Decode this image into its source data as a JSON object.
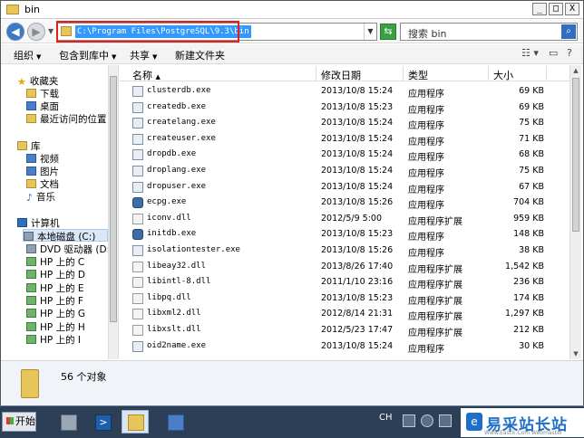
{
  "window": {
    "title": "bin",
    "controls": [
      "_",
      "□",
      "X"
    ]
  },
  "address": {
    "path": "C:\\Program Files\\PostgreSQL\\9.3\\bin",
    "search_placeholder": "搜索 bin"
  },
  "toolbar": {
    "organize": "组织",
    "include_in_library": "包含到库中",
    "share": "共享",
    "new_folder": "新建文件夹"
  },
  "nav": {
    "favorites": "收藏夹",
    "downloads": "下载",
    "desktop": "桌面",
    "recent": "最近访问的位置",
    "libraries": "库",
    "videos": "视频",
    "pictures": "图片",
    "documents": "文档",
    "music": "音乐",
    "computer": "计算机",
    "local_disk": "本地磁盘 (C:)",
    "dvd_drive": "DVD 驱动器 (D:)",
    "net_drives": [
      "HP 上的 C",
      "HP 上的 D",
      "HP 上的 E",
      "HP 上的 F",
      "HP 上的 G",
      "HP 上的 H",
      "HP 上的 I"
    ]
  },
  "columns": {
    "name": "名称",
    "modified": "修改日期",
    "type": "类型",
    "size": "大小"
  },
  "files": [
    {
      "name": "clusterdb.exe",
      "date": "2013/10/8 15:24",
      "type": "应用程序",
      "size": "69 KB",
      "kind": "exe"
    },
    {
      "name": "createdb.exe",
      "date": "2013/10/8 15:23",
      "type": "应用程序",
      "size": "69 KB",
      "kind": "exe"
    },
    {
      "name": "createlang.exe",
      "date": "2013/10/8 15:24",
      "type": "应用程序",
      "size": "75 KB",
      "kind": "exe"
    },
    {
      "name": "createuser.exe",
      "date": "2013/10/8 15:24",
      "type": "应用程序",
      "size": "71 KB",
      "kind": "exe"
    },
    {
      "name": "dropdb.exe",
      "date": "2013/10/8 15:24",
      "type": "应用程序",
      "size": "68 KB",
      "kind": "exe"
    },
    {
      "name": "droplang.exe",
      "date": "2013/10/8 15:24",
      "type": "应用程序",
      "size": "75 KB",
      "kind": "exe"
    },
    {
      "name": "dropuser.exe",
      "date": "2013/10/8 15:24",
      "type": "应用程序",
      "size": "67 KB",
      "kind": "exe"
    },
    {
      "name": "ecpg.exe",
      "date": "2013/10/8 15:26",
      "type": "应用程序",
      "size": "704 KB",
      "kind": "special"
    },
    {
      "name": "iconv.dll",
      "date": "2012/5/9 5:00",
      "type": "应用程序扩展",
      "size": "959 KB",
      "kind": "dll"
    },
    {
      "name": "initdb.exe",
      "date": "2013/10/8 15:23",
      "type": "应用程序",
      "size": "148 KB",
      "kind": "special"
    },
    {
      "name": "isolationtester.exe",
      "date": "2013/10/8 15:26",
      "type": "应用程序",
      "size": "38 KB",
      "kind": "exe"
    },
    {
      "name": "libeay32.dll",
      "date": "2013/8/26 17:40",
      "type": "应用程序扩展",
      "size": "1,542 KB",
      "kind": "dll"
    },
    {
      "name": "libintl-8.dll",
      "date": "2011/1/10 23:16",
      "type": "应用程序扩展",
      "size": "236 KB",
      "kind": "dll"
    },
    {
      "name": "libpq.dll",
      "date": "2013/10/8 15:23",
      "type": "应用程序扩展",
      "size": "174 KB",
      "kind": "dll"
    },
    {
      "name": "libxml2.dll",
      "date": "2012/8/14 21:31",
      "type": "应用程序扩展",
      "size": "1,297 KB",
      "kind": "dll"
    },
    {
      "name": "libxslt.dll",
      "date": "2012/5/23 17:47",
      "type": "应用程序扩展",
      "size": "212 KB",
      "kind": "dll"
    },
    {
      "name": "oid2name.exe",
      "date": "2013/10/8 15:24",
      "type": "应用程序",
      "size": "30 KB",
      "kind": "exe"
    }
  ],
  "details": {
    "count": "56 个对象"
  },
  "taskbar": {
    "start": "开始",
    "lang": "CH"
  },
  "brand": {
    "name": "易采站长站",
    "url": "Www.Easck.Com Webmaster"
  }
}
